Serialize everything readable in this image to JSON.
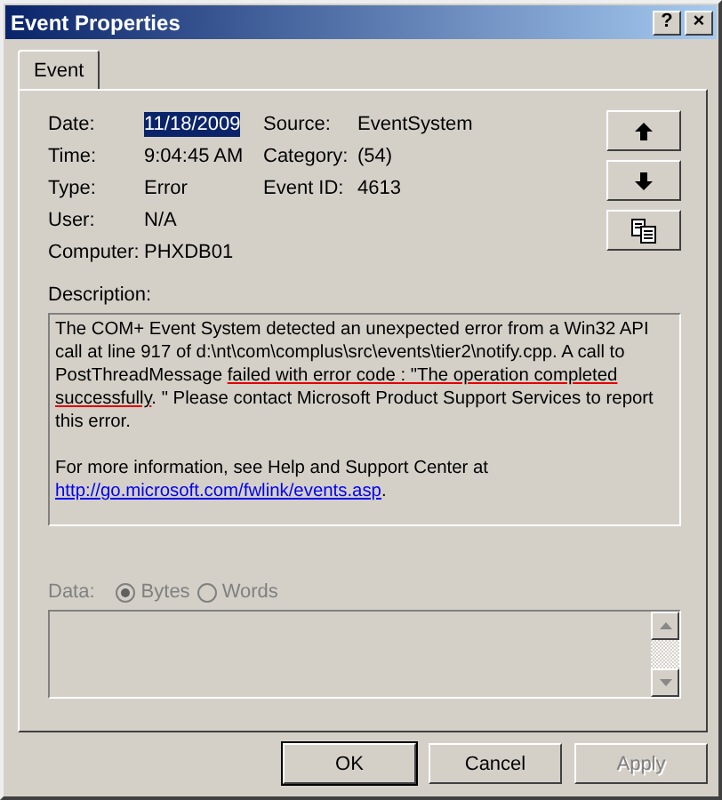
{
  "window": {
    "title": "Event Properties",
    "title_buttons": [
      "?",
      "×"
    ]
  },
  "tabs": [
    {
      "label": "Event",
      "selected": true
    }
  ],
  "field_rows": [
    [
      {
        "label": "Date:",
        "value": "11/18/2009",
        "selected": true
      },
      {
        "label": "Source:",
        "value": "EventSystem",
        "selected": false
      }
    ],
    [
      {
        "label": "Time:",
        "value": "9:04:45 AM",
        "selected": false
      },
      {
        "label": "Category:",
        "value": "(54)",
        "selected": false
      }
    ],
    [
      {
        "label": "Type:",
        "value": "Error",
        "selected": false
      },
      {
        "label": "Event ID:",
        "value": "4613",
        "selected": false
      }
    ],
    [
      {
        "label": "User:",
        "value": "N/A",
        "selected": false
      }
    ],
    [
      {
        "label": "Computer:",
        "value": "PHXDB01",
        "selected": false
      }
    ]
  ],
  "nav_buttons": [
    {
      "kind": "up"
    },
    {
      "kind": "down"
    },
    {
      "kind": "copy"
    }
  ],
  "description": {
    "label": "Description:",
    "runs": [
      {
        "text": "The COM+ Event System detected an unexpected error from a Win32 API call at line 917 of d:\\nt\\com\\complus\\src\\events\\tier2\\notify.cpp.  A call to PostThreadMessage ",
        "marked": false
      },
      {
        "text": "failed with error code : \"The operation completed successfully",
        "marked": true
      },
      {
        "text": ". \"  Please contact Microsoft Product Support Services to report this error.",
        "marked": false
      }
    ],
    "more": "For more information, see Help and Support Center at",
    "link": "http://go.microsoft.com/fwlink/events.asp",
    "after_link": "."
  },
  "data": {
    "label": "Data:",
    "disabled": true,
    "options": [
      {
        "label": "Bytes",
        "selected": true
      },
      {
        "label": "Words",
        "selected": false
      }
    ]
  },
  "buttons": [
    {
      "label": "OK",
      "default": true,
      "disabled": false
    },
    {
      "label": "Cancel",
      "default": false,
      "disabled": false
    },
    {
      "label": "Apply",
      "default": false,
      "disabled": true
    }
  ]
}
